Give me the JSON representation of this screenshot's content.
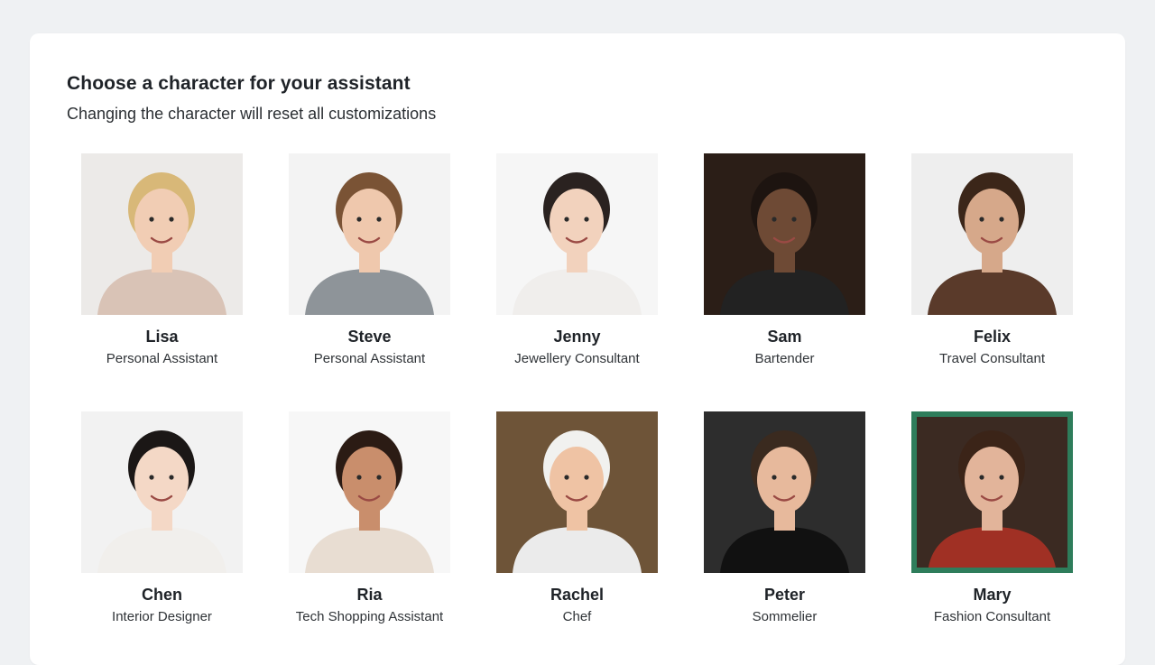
{
  "header": {
    "title": "Choose a character for your assistant",
    "subtitle": "Changing the character will reset all customizations"
  },
  "characters": [
    {
      "name": "Lisa",
      "role": "Personal Assistant",
      "bg": "#eceae8",
      "skin": "#f1cdb4",
      "hair": "#d8b878",
      "top": "#d9c3b6"
    },
    {
      "name": "Steve",
      "role": "Personal Assistant",
      "bg": "#f3f3f3",
      "skin": "#efc8ad",
      "hair": "#7a5335",
      "top": "#8e9499"
    },
    {
      "name": "Jenny",
      "role": "Jewellery Consultant",
      "bg": "#f6f6f6",
      "skin": "#f2d2bd",
      "hair": "#2a2220",
      "top": "#f0eeec"
    },
    {
      "name": "Sam",
      "role": "Bartender",
      "bg": "#2b1e17",
      "skin": "#6e4a35",
      "hair": "#1d1410",
      "top": "#222222"
    },
    {
      "name": "Felix",
      "role": "Travel Consultant",
      "bg": "#eeeeee",
      "skin": "#d6a88a",
      "hair": "#3b2619",
      "top": "#5a3a2a"
    },
    {
      "name": "Chen",
      "role": "Interior Designer",
      "bg": "#f2f2f2",
      "skin": "#f4d8c6",
      "hair": "#1b1716",
      "top": "#f1efec"
    },
    {
      "name": "Ria",
      "role": "Tech Shopping Assistant",
      "bg": "#f7f7f7",
      "skin": "#c98e6c",
      "hair": "#2b1b14",
      "top": "#e8ddd2"
    },
    {
      "name": "Rachel",
      "role": "Chef",
      "bg": "#6e5438",
      "skin": "#efc3a4",
      "hair": "#f1f1ef",
      "top": "#ebebeb"
    },
    {
      "name": "Peter",
      "role": "Sommelier",
      "bg": "#2d2d2d",
      "skin": "#e7b99c",
      "hair": "#3a2a1f",
      "top": "#111111"
    },
    {
      "name": "Mary",
      "role": "Fashion Consultant",
      "bg": "#3b2a22",
      "skin": "#e2b49a",
      "hair": "#3b2418",
      "top": "#a03024",
      "selected": true
    }
  ],
  "colors": {
    "selected_border": "#2e7d5b"
  }
}
